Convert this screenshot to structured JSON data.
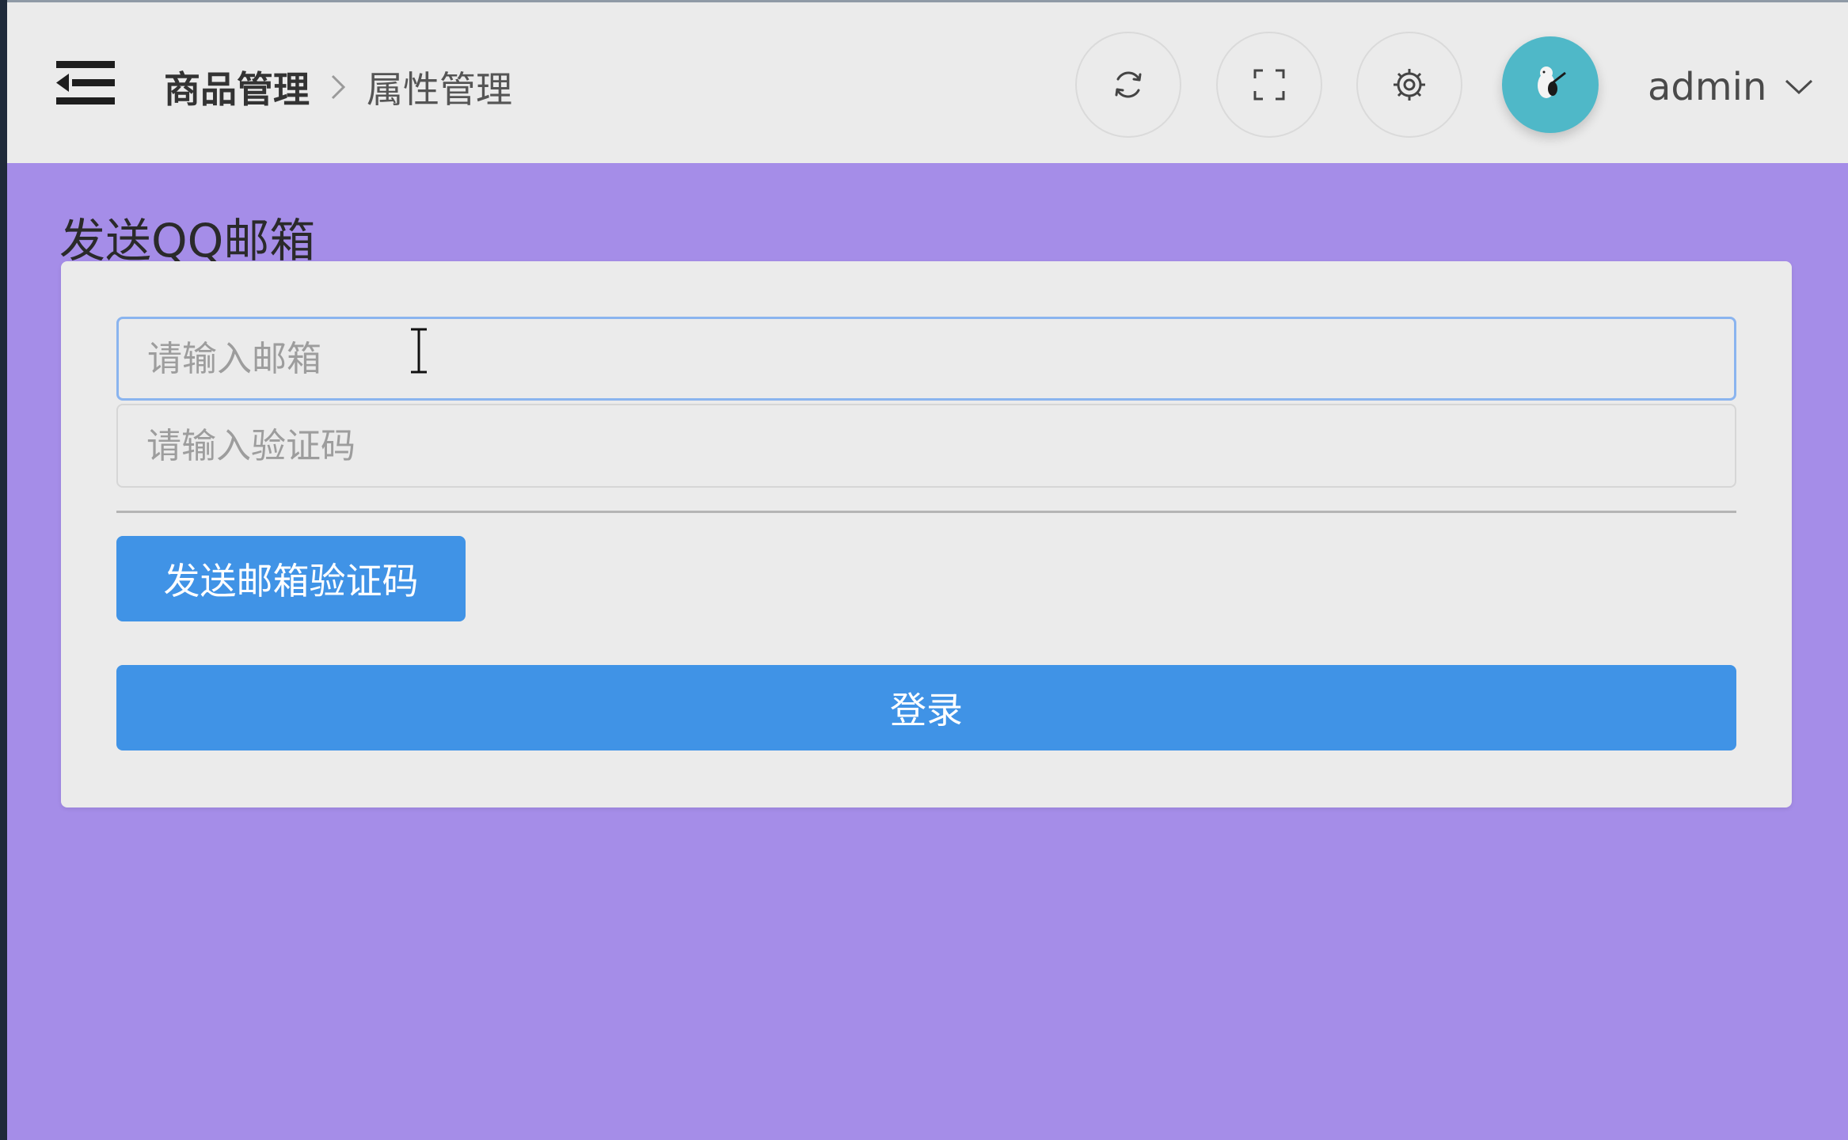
{
  "header": {
    "breadcrumb": [
      "商品管理",
      "属性管理"
    ],
    "user_name": "admin",
    "icons": {
      "menu": "menu-fold-icon",
      "refresh": "refresh-icon",
      "fullscreen": "fullscreen-icon",
      "settings": "gear-icon",
      "avatar": "avatar-icon",
      "user_dropdown": "chevron-down-icon"
    }
  },
  "form": {
    "title": "发送QQ邮箱",
    "email": {
      "value": "",
      "placeholder": "请输入邮箱"
    },
    "code": {
      "value": "",
      "placeholder": "请输入验证码"
    },
    "send_button": "发送邮箱验证码",
    "login_button": "登录"
  },
  "colors": {
    "page_background": "#a58de8",
    "header_background": "#ebebeb",
    "card_background": "#ebebeb",
    "primary": "#4093e6",
    "avatar_background": "#4fb8c8",
    "focus_border": "#8ab4ef"
  }
}
